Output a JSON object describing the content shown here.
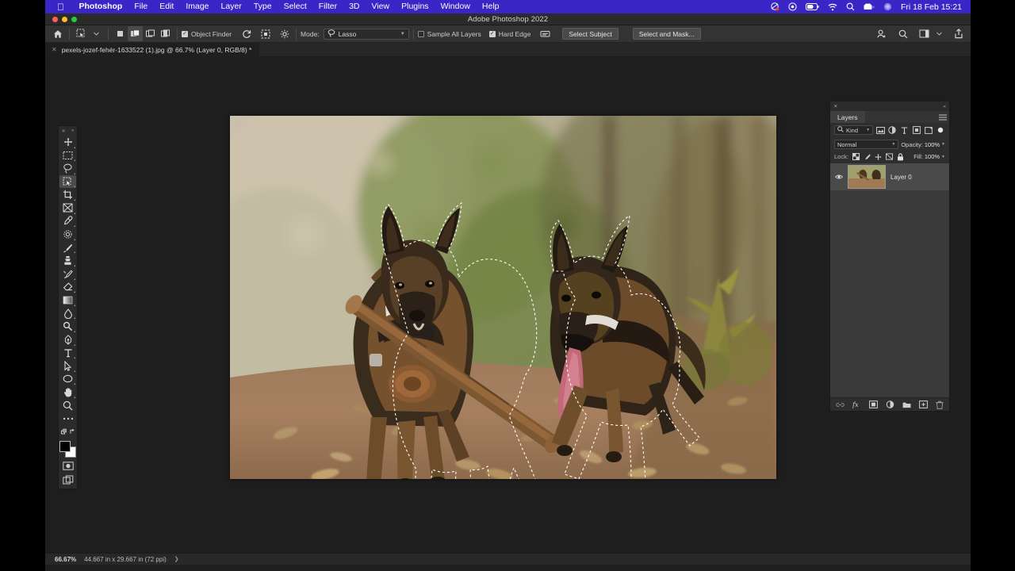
{
  "menubar": {
    "apple_icon": "apple-icon",
    "app_name": "Photoshop",
    "items": [
      "File",
      "Edit",
      "Image",
      "Layer",
      "Type",
      "Select",
      "Filter",
      "3D",
      "View",
      "Plugins",
      "Window",
      "Help"
    ],
    "status_icons": [
      "screen-record-icon",
      "control-center-icon",
      "battery-icon",
      "wifi-icon",
      "spotlight-search-icon",
      "dropbox-icon",
      "siri-icon"
    ],
    "clock": "Fri 18 Feb  15:21",
    "bar_color": "#3a25c6"
  },
  "window": {
    "title": "Adobe Photoshop 2022",
    "traffic_lights": [
      "close-red",
      "minimize-yellow",
      "zoom-green"
    ]
  },
  "options_bar": {
    "home_icon": "home-icon",
    "tool_preset_icon": "object-selection-tool-icon",
    "selection_modes": [
      "new-selection-icon",
      "add-to-selection-icon",
      "subtract-from-selection-icon",
      "intersect-selection-icon"
    ],
    "active_selection_mode": 1,
    "object_finder": {
      "label": "Object Finder",
      "checked": true
    },
    "refresh_icon": "refresh-icon",
    "show_overlay_icon": "show-all-objects-icon",
    "settings_icon": "gear-icon",
    "mode": {
      "label": "Mode:",
      "value": "Lasso",
      "icon": "lasso-icon"
    },
    "sample_all_layers": {
      "label": "Sample All Layers",
      "checked": false
    },
    "hard_edge": {
      "label": "Hard Edge",
      "checked": true
    },
    "feedback_icon": "feedback-icon",
    "select_subject": "Select Subject",
    "select_and_mask": "Select and Mask...",
    "right_icons": [
      "share-user-icon",
      "search-icon",
      "workspace-icon",
      "chevron-down-icon",
      "share-export-icon"
    ]
  },
  "document_tab": {
    "close_icon": "close-icon",
    "title": "pexels-jozef-fehér-1633522 (1).jpg @ 66.7% (Layer 0, RGB/8) *"
  },
  "tools_panel": {
    "close_icon": "close-icon",
    "collapse_icon": "collapse-icon",
    "items": [
      {
        "name": "move-tool",
        "active": false
      },
      {
        "name": "rectangular-marquee-tool",
        "active": false
      },
      {
        "name": "lasso-tool",
        "active": false
      },
      {
        "name": "object-selection-tool",
        "active": true
      },
      {
        "name": "crop-tool",
        "active": false
      },
      {
        "name": "frame-tool",
        "active": false
      },
      {
        "name": "eyedropper-tool",
        "active": false
      },
      {
        "name": "spot-healing-brush-tool",
        "active": false
      },
      {
        "name": "brush-tool",
        "active": false
      },
      {
        "name": "clone-stamp-tool",
        "active": false
      },
      {
        "name": "history-brush-tool",
        "active": false
      },
      {
        "name": "eraser-tool",
        "active": false
      },
      {
        "name": "gradient-tool",
        "active": false
      },
      {
        "name": "blur-tool",
        "active": false
      },
      {
        "name": "dodge-tool",
        "active": false
      },
      {
        "name": "pen-tool",
        "active": false
      },
      {
        "name": "type-tool",
        "active": false
      },
      {
        "name": "path-selection-tool",
        "active": false
      },
      {
        "name": "ellipse-shape-tool",
        "active": false
      },
      {
        "name": "hand-tool",
        "active": false
      },
      {
        "name": "zoom-tool",
        "active": false
      },
      {
        "name": "edit-toolbar-ellipsis",
        "active": false
      }
    ],
    "foreground_color": "#000000",
    "background_color": "#ffffff",
    "quick_mask_icon": "quick-mask-mode-icon",
    "screen_mode_icon": "screen-mode-icon"
  },
  "layers_panel": {
    "title": "Layers",
    "close_icon": "close-icon",
    "collapse_icon": "collapse-panel-icon",
    "menu_icon": "panel-menu-icon",
    "filter": {
      "icon": "search-icon",
      "value": "Kind"
    },
    "filter_icons": [
      "pixel-layer-filter-icon",
      "adjustment-layer-filter-icon",
      "type-layer-filter-icon",
      "shape-layer-filter-icon",
      "smart-object-filter-icon"
    ],
    "filter_toggle_icon": "filter-enable-toggle-icon",
    "blend_mode": "Normal",
    "opacity": {
      "label": "Opacity:",
      "value": "100%"
    },
    "lock": {
      "label": "Lock:",
      "icons": [
        "lock-transparent-pixels-icon",
        "lock-image-pixels-icon",
        "lock-position-icon",
        "lock-artboard-nesting-icon",
        "lock-all-icon"
      ]
    },
    "fill": {
      "label": "Fill:",
      "value": "100%"
    },
    "layers": [
      {
        "name": "Layer 0",
        "visible": true,
        "selected": true,
        "visibility_icon": "eye-icon",
        "thumbnail": "layer-thumbnail"
      }
    ],
    "bottom_icons": [
      "link-layers-icon",
      "layer-style-fx-icon",
      "add-layer-mask-icon",
      "new-adjustment-layer-icon",
      "new-group-icon",
      "new-layer-icon",
      "delete-layer-icon"
    ]
  },
  "status_bar": {
    "zoom": "66.67%",
    "doc_size": "44.667 in x 29.667 in (72 ppi)",
    "expand_icon": "chevron-right-icon"
  },
  "canvas": {
    "image_description": "two-dogs-running-on-dirt-path-photo",
    "selection_active": true
  }
}
